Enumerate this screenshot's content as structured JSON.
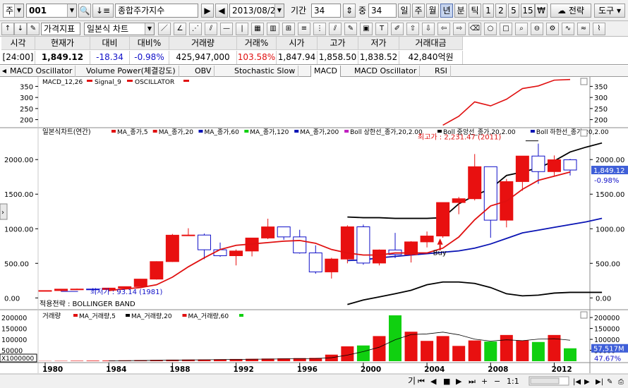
{
  "toolbar": {
    "market_type": "주",
    "code": "001",
    "name": "종합주가지수",
    "date": "2013/08/22",
    "period_label": "기간",
    "period_value": "34",
    "mid_label": "중",
    "mid_value": "34",
    "cycles": [
      "일",
      "주",
      "월",
      "년",
      "분",
      "틱"
    ],
    "active_cycle": "년",
    "nums": [
      "1",
      "2",
      "5",
      "15"
    ],
    "won_icon": "₩",
    "strategy": "전략",
    "tools": "도구",
    "price_indicator": "가격지표",
    "chart_type": "일본식 차트"
  },
  "quote": {
    "headers": [
      "시각",
      "현재가",
      "대비",
      "대비%",
      "거래량",
      "거래%",
      "시가",
      "고가",
      "저가",
      "거래대금"
    ],
    "values": [
      "[24:00]",
      "1,849.12",
      "-18.34",
      "-0.98%",
      "425,947,000",
      "103.58%",
      "1,847.94",
      "1,858.50",
      "1,838.52",
      "42,840억원"
    ]
  },
  "tabs": [
    "MACD Oscillator",
    "Volume Power(체결강도)",
    "OBV",
    "Stochastic Slow",
    "MACD",
    "MACD Oscillator",
    "RSI"
  ],
  "active_tab": "MACD",
  "colors": {
    "up": "#e81010",
    "down": "#1010c8",
    "ma5": "#e01010",
    "ma20": "#000000",
    "ma60": "#0a14b4",
    "ma120": "#10d010",
    "ma200": "#0a14b4",
    "boll": "#000000",
    "vol_up": "#e81010",
    "vol_up_high": "#10d010",
    "accent": "#3f5fd8"
  },
  "chart_data": [
    {
      "type": "line",
      "title": "MACD_12,26 ▪ Signal_9 ▪ OSCILLATOR",
      "legend": [
        "MACD_12,26",
        "Signal_9",
        "OSCILLATOR"
      ],
      "x": [
        2005,
        2006,
        2007,
        2008,
        2009,
        2010,
        2011,
        2012,
        2013
      ],
      "series": [
        {
          "name": "MACD_12,26",
          "values": [
            175,
            215,
            280,
            262,
            292,
            340,
            352,
            378,
            381
          ]
        }
      ],
      "y_ticks": [
        350,
        300,
        250,
        200
      ],
      "ylim": [
        170,
        380
      ]
    },
    {
      "type": "candlestick",
      "title": "일본식차트(연간)",
      "legend": [
        "MA_종가,5",
        "MA_종가,20",
        "MA_종가,60",
        "MA_종가,120",
        "MA_종가,200",
        "Boll 상한선_종가,20,2.00",
        "Boll 중앙선_종가,20,2.00",
        "Boll 하한선_종가,20,2.00"
      ],
      "x": [
        1980,
        1981,
        1982,
        1983,
        1984,
        1985,
        1986,
        1987,
        1988,
        1989,
        1990,
        1991,
        1992,
        1993,
        1994,
        1995,
        1996,
        1997,
        1998,
        1999,
        2000,
        2001,
        2002,
        2003,
        2004,
        2005,
        2006,
        2007,
        2008,
        2009,
        2010,
        2011,
        2012,
        2013
      ],
      "candles": [
        [
          100,
          110,
          95,
          106
        ],
        [
          106,
          131,
          93,
          127
        ],
        [
          127,
          135,
          118,
          128
        ],
        [
          128,
          140,
          115,
          121
        ],
        [
          121,
          145,
          118,
          142
        ],
        [
          142,
          165,
          138,
          163
        ],
        [
          163,
          275,
          160,
          272
        ],
        [
          272,
          530,
          265,
          525
        ],
        [
          525,
          925,
          520,
          907
        ],
        [
          907,
          1007,
          905,
          909
        ],
        [
          909,
          930,
          560,
          696
        ],
        [
          696,
          800,
          595,
          610
        ],
        [
          610,
          700,
          470,
          678
        ],
        [
          678,
          870,
          600,
          866
        ],
        [
          866,
          1145,
          850,
          1027
        ],
        [
          1027,
          1010,
          840,
          882
        ],
        [
          882,
          985,
          640,
          651
        ],
        [
          651,
          760,
          350,
          376
        ],
        [
          376,
          580,
          280,
          562
        ],
        [
          562,
          1050,
          500,
          1028
        ],
        [
          1028,
          1060,
          480,
          504
        ],
        [
          504,
          700,
          470,
          693
        ],
        [
          693,
          940,
          575,
          627
        ],
        [
          627,
          820,
          512,
          810
        ],
        [
          810,
          960,
          730,
          895
        ],
        [
          895,
          1380,
          870,
          1379
        ],
        [
          1379,
          1460,
          1210,
          1434
        ],
        [
          1434,
          2080,
          1410,
          1897
        ],
        [
          1897,
          1890,
          870,
          1124
        ],
        [
          1124,
          1720,
          1020,
          1682
        ],
        [
          1682,
          2050,
          1550,
          2051
        ],
        [
          2051,
          2231,
          1650,
          1826
        ],
        [
          1826,
          2060,
          1770,
          1997
        ],
        [
          1997,
          2010,
          1770,
          1849
        ]
      ],
      "ma5": [
        null,
        null,
        null,
        null,
        107,
        130,
        150,
        190,
        300,
        450,
        580,
        700,
        760,
        780,
        800,
        820,
        830,
        790,
        700,
        650,
        620,
        620,
        650,
        650,
        650,
        720,
        880,
        1130,
        1330,
        1400,
        1570,
        1700,
        1760,
        1820
      ],
      "ma20_upper": [
        1170,
        1160,
        1160,
        1150,
        1150,
        1150,
        1160,
        1360,
        1480,
        1580,
        1770,
        1820,
        1880,
        1980,
        2110,
        2180,
        2240
      ],
      "ma20_lower": [
        -95,
        -30,
        15,
        60,
        110,
        190,
        230,
        230,
        210,
        150,
        60,
        30,
        40,
        70,
        80,
        80,
        80
      ],
      "ma60": [
        540,
        550,
        580,
        600,
        620,
        640,
        660,
        680,
        720,
        780,
        860,
        940,
        980,
        1020,
        1060,
        1100,
        1150
      ],
      "bollinger_start_year": 1999,
      "highest_label": "최고가 : 2,231.47 (2011)",
      "lowest_label": "최저가 : 93.14 (1981)",
      "buy_label": "Buy",
      "strategy_label": "적용전략 : BOLLINGER BAND",
      "last_price": "1,849.12",
      "last_change_pct": "-0.98%",
      "y_ticks": [
        2000,
        1500,
        1000,
        500,
        0
      ],
      "y_tick_labels": [
        "2000.00",
        "1500.00",
        "1000.00",
        "500.00",
        "0.00"
      ],
      "ylim": [
        -150,
        2400
      ]
    },
    {
      "type": "bar",
      "title": "거래량",
      "legend": [
        "MA_거래량,5",
        "MA_거래량,20",
        "MA_거래량,60"
      ],
      "x": [
        1980,
        1981,
        1982,
        1983,
        1984,
        1985,
        1986,
        1987,
        1988,
        1989,
        1990,
        1991,
        1992,
        1993,
        1994,
        1995,
        1996,
        1997,
        1998,
        1999,
        2000,
        2001,
        2002,
        2003,
        2004,
        2005,
        2006,
        2007,
        2008,
        2009,
        2010,
        2011,
        2012,
        2013
      ],
      "values": [
        1000,
        1500,
        2000,
        2500,
        3000,
        4000,
        5000,
        6000,
        7000,
        7500,
        8000,
        9000,
        10000,
        11000,
        12000,
        13000,
        14000,
        15000,
        30000,
        68000,
        72000,
        115000,
        210000,
        135000,
        93000,
        115000,
        70000,
        95000,
        90000,
        120000,
        95000,
        88000,
        120000,
        59000
      ],
      "y_tick_labels": [
        "200000",
        "150000",
        "100000",
        "50000",
        "X1000000"
      ],
      "ylim": [
        0,
        210000
      ],
      "last_volume": "57,517M",
      "last_volume_pct": "47.67%"
    }
  ],
  "x_axis": [
    "1980",
    "1984",
    "1988",
    "1992",
    "1996",
    "2000",
    "2004",
    "2008",
    "2012"
  ],
  "footer": {
    "label": "기"
  }
}
